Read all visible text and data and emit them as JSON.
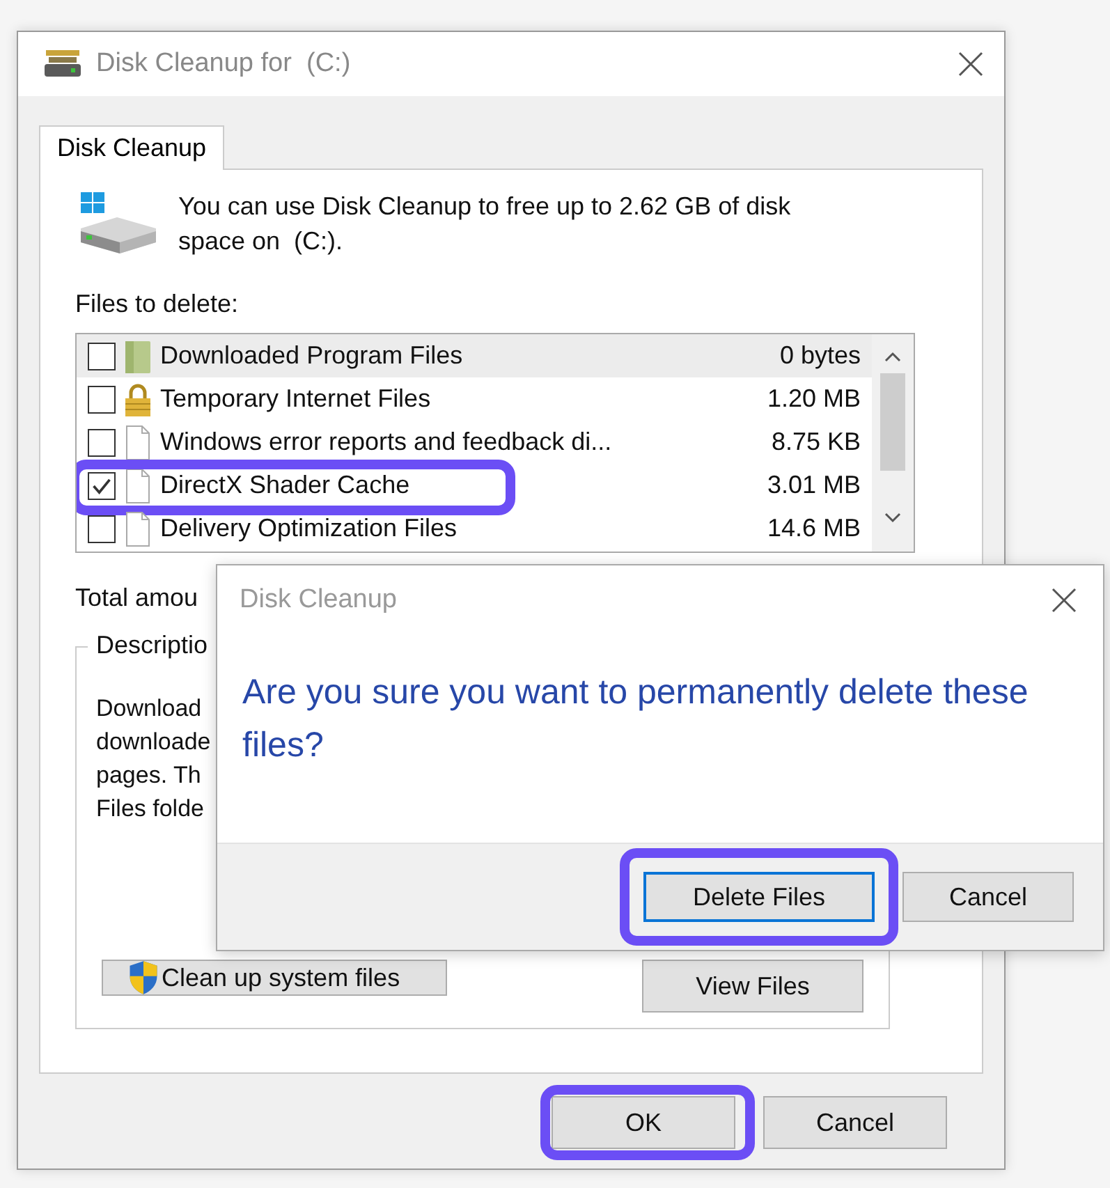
{
  "window": {
    "title": "Disk Cleanup for  (C:)"
  },
  "tabs": [
    {
      "label": "Disk Cleanup",
      "selected": true
    }
  ],
  "intro": "You can use Disk Cleanup to free up to 2.62 GB of disk space on  (C:).",
  "files_label": "Files to delete:",
  "files": [
    {
      "name": "Downloaded Program Files",
      "size": "0 bytes",
      "checked": false,
      "selected": true,
      "highlighted": false,
      "kind": "folder"
    },
    {
      "name": "Temporary Internet Files",
      "size": "1.20 MB",
      "checked": false,
      "selected": false,
      "highlighted": false,
      "kind": "lock"
    },
    {
      "name": "Windows error reports and feedback di...",
      "size": "8.75 KB",
      "checked": false,
      "selected": false,
      "highlighted": false,
      "kind": "document"
    },
    {
      "name": "DirectX Shader Cache",
      "size": "3.01 MB",
      "checked": true,
      "selected": false,
      "highlighted": true,
      "kind": "document"
    },
    {
      "name": "Delivery Optimization Files",
      "size": "14.6 MB",
      "checked": false,
      "selected": false,
      "highlighted": false,
      "kind": "document"
    }
  ],
  "total_label": "Total amou",
  "description": {
    "title": "Descriptio",
    "lines": [
      "Download",
      "downloade",
      "pages. Th",
      "Files folde"
    ]
  },
  "actions": [
    {
      "label": "Clean up system files",
      "kind": "shield"
    },
    {
      "label": "View Files",
      "kind": "plain"
    }
  ],
  "footer_buttons": [
    {
      "label": "OK",
      "highlighted": true
    },
    {
      "label": "Cancel",
      "highlighted": false
    }
  ],
  "confirm": {
    "title": "Disk Cleanup",
    "message": "Are you sure you want to permanently delete these files?",
    "buttons": [
      {
        "label": "Delete Files",
        "default": true,
        "highlighted": true
      },
      {
        "label": "Cancel",
        "default": false,
        "highlighted": false
      }
    ]
  }
}
